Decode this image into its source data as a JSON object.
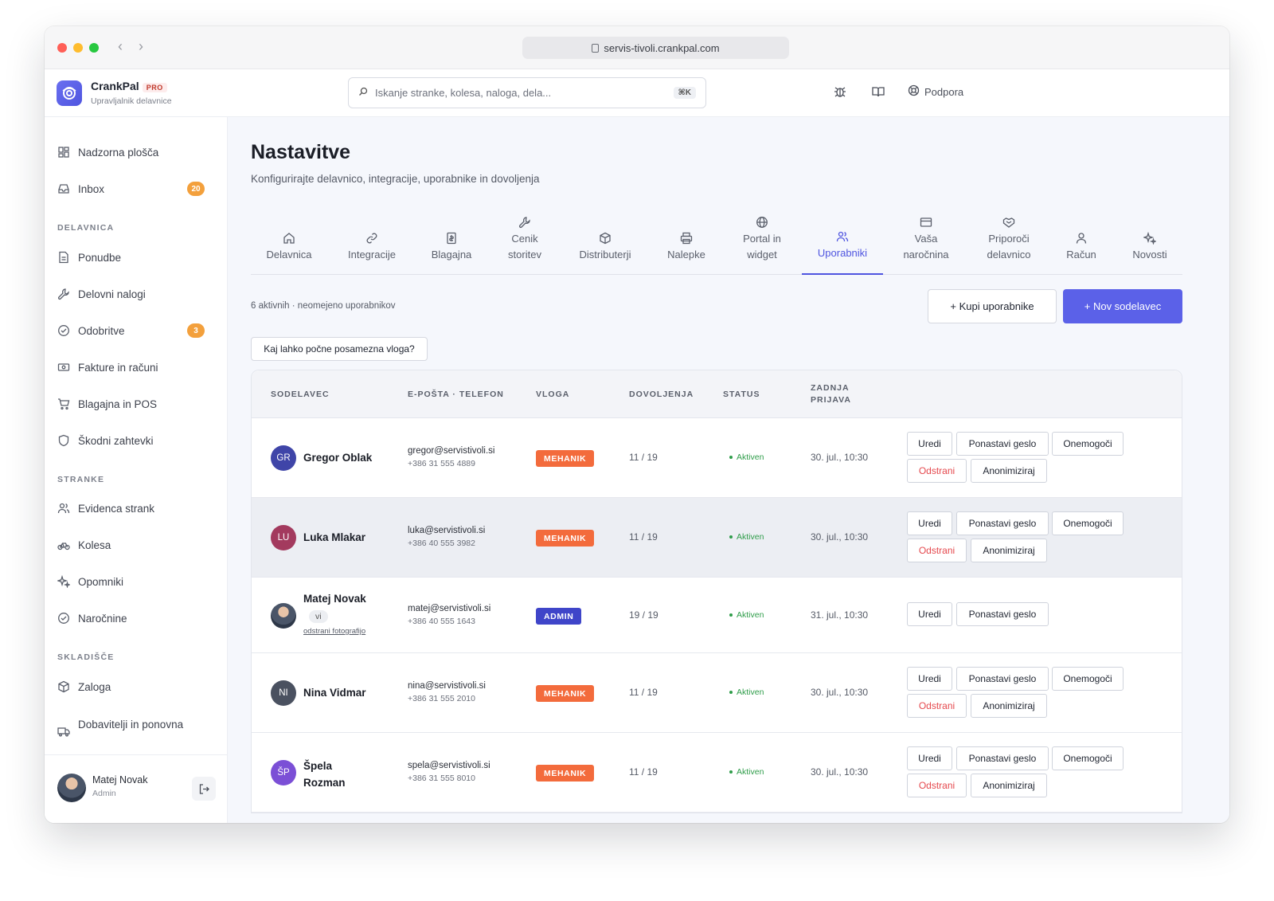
{
  "browser": {
    "url": "servis-tivoli.crankpal.com"
  },
  "brand": {
    "name": "CrankPal",
    "badge": "PRO",
    "subtitle": "Upravljalnik delavnice"
  },
  "search": {
    "placeholder": "Iskanje stranke, kolesa, naloga, dela...",
    "shortcut": "⌘K"
  },
  "header": {
    "support_label": "Podpora"
  },
  "sidebar": {
    "dashboard": "Nadzorna plošča",
    "inbox": "Inbox",
    "inbox_count": "20",
    "section_workshop": "DELAVNICA",
    "offers": "Ponudbe",
    "work_orders": "Delovni nalogi",
    "approvals": "Odobritve",
    "approvals_count": "3",
    "invoices": "Fakture in računi",
    "pos": "Blagajna in POS",
    "claims": "Škodni zahtevki",
    "section_customers": "STRANKE",
    "customer_records": "Evidenca strank",
    "bikes": "Kolesa",
    "reminders": "Opomniki",
    "subscriptions": "Naročnine",
    "section_warehouse": "SKLADIŠČE",
    "stock": "Zaloga",
    "suppliers": "Dobavitelji in ponovna",
    "user": {
      "name": "Matej Novak",
      "role": "Admin"
    }
  },
  "page": {
    "title": "Nastavitve",
    "subtitle": "Konfigurirajte delavnico, integracije, uporabnike in dovoljenja",
    "tabs": [
      {
        "l1": "Delavnica",
        "l2": ""
      },
      {
        "l1": "Integracije",
        "l2": ""
      },
      {
        "l1": "Blagajna",
        "l2": ""
      },
      {
        "l1": "Cenik",
        "l2": "storitev"
      },
      {
        "l1": "Distributerji",
        "l2": ""
      },
      {
        "l1": "Nalepke",
        "l2": ""
      },
      {
        "l1": "Portal in",
        "l2": "widget"
      },
      {
        "l1": "Uporabniki",
        "l2": ""
      },
      {
        "l1": "Vaša",
        "l2": "naročnina"
      },
      {
        "l1": "Priporoči",
        "l2": "delavnico"
      },
      {
        "l1": "Račun",
        "l2": ""
      },
      {
        "l1": "Novosti",
        "l2": ""
      }
    ],
    "active_tab": "Uporabniki",
    "counts": "6 aktivnih · neomejeno uporabnikov",
    "buy_users": "+ Kupi uporabnike",
    "new_member": "+ Nov sodelavec",
    "roles_help": "Kaj lahko počne posamezna vloga?"
  },
  "table": {
    "headers": {
      "member": "SODELAVEC",
      "contact": "E-POŠTA · TELEFON",
      "role": "VLOGA",
      "permissions": "DOVOLJENJA",
      "status": "STATUS",
      "last_login_1": "ZADNJA",
      "last_login_2": "PRIJAVA"
    },
    "actions": {
      "edit": "Uredi",
      "reset": "Ponastavi geslo",
      "disable": "Onemogoči",
      "remove": "Odstrani",
      "anonymize": "Anonimiziraj"
    },
    "me_chip": "vi",
    "remove_photo": "odstrani fotografijo",
    "rows": [
      {
        "initials": "GR",
        "name": "Gregor Oblak",
        "email": "gregor@servistivoli.si",
        "phone": "+386 31 555 4889",
        "role": "MEHANIK",
        "perms": "11 / 19",
        "status": "Aktiven",
        "last": "30. jul., 10:30",
        "avatar_color": "#3f45a8"
      },
      {
        "initials": "LU",
        "name": "Luka Mlakar",
        "email": "luka@servistivoli.si",
        "phone": "+386 40 555 3982",
        "role": "MEHANIK",
        "perms": "11 / 19",
        "status": "Aktiven",
        "last": "30. jul., 10:30",
        "avatar_color": "#a33a5e"
      },
      {
        "initials": "",
        "name": "Matej Novak",
        "email": "matej@servistivoli.si",
        "phone": "+386 40 555 1643",
        "role": "ADMIN",
        "perms": "19 / 19",
        "status": "Aktiven",
        "last": "31. jul., 10:30",
        "avatar_color": "#2d3748"
      },
      {
        "initials": "NI",
        "name": "Nina Vidmar",
        "email": "nina@servistivoli.si",
        "phone": "+386 31 555 2010",
        "role": "MEHANIK",
        "perms": "11 / 19",
        "status": "Aktiven",
        "last": "30. jul., 10:30",
        "avatar_color": "#4a5160"
      },
      {
        "initials": "ŠP",
        "name_1": "Špela",
        "name_2": "Rozman",
        "email": "spela@servistivoli.si",
        "phone": "+386 31 555 8010",
        "role": "MEHANIK",
        "perms": "11 / 19",
        "status": "Aktiven",
        "last": "30. jul., 10:30",
        "avatar_color": "#7b4fd6"
      }
    ]
  },
  "colors": {
    "accent": "#5b61e8",
    "mechanic": "#f36b3c",
    "admin": "#3f45c9",
    "active": "#2f9d4a",
    "badge": "#f3a03c"
  }
}
